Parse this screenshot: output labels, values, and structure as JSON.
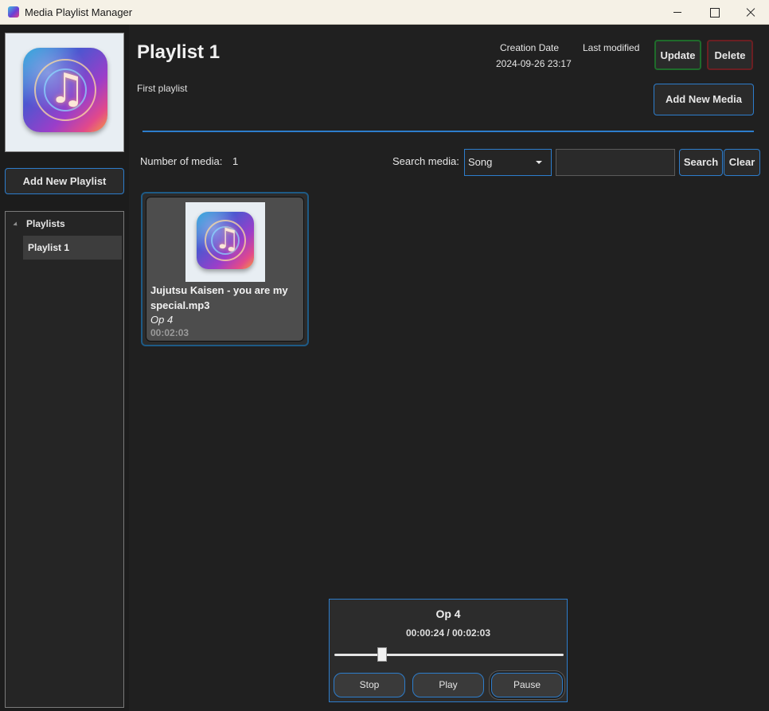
{
  "window": {
    "title": "Media Playlist Manager",
    "app_icon": "music-app-icon"
  },
  "sidebar": {
    "cover_icon": "music-note-art",
    "add_playlist_label": "Add New Playlist",
    "tree": {
      "root_label": "Playlists",
      "items": [
        {
          "label": "Playlist 1",
          "selected": true
        }
      ]
    }
  },
  "header": {
    "title": "Playlist 1",
    "description": "First playlist",
    "creation_label": "Creation Date",
    "creation_value": "2024-09-26 23:17",
    "modified_label": "Last modified",
    "modified_value": "",
    "update_label": "Update",
    "delete_label": "Delete",
    "add_media_label": "Add New Media"
  },
  "toolbar": {
    "count_label": "Number of media:",
    "count_value": "1",
    "search_label": "Search media:",
    "filter_selected": "Song",
    "search_value": "",
    "search_button": "Search",
    "clear_button": "Clear"
  },
  "media": [
    {
      "name": "Jujutsu Kaisen - you are my special.mp3",
      "title": "Op 4",
      "duration": "00:02:03",
      "thumbnail": "music-note-art"
    }
  ],
  "player": {
    "title": "Op 4",
    "time": "00:00:24 / 00:02:03",
    "progress_fraction": 0.195,
    "stop_label": "Stop",
    "play_label": "Play",
    "pause_label": "Pause"
  },
  "colors": {
    "background": "#202020",
    "accent": "#2d7dcc",
    "update_border": "#1f6b2b",
    "delete_border": "#6b1f22",
    "card_bg": "#4d4d4d"
  }
}
